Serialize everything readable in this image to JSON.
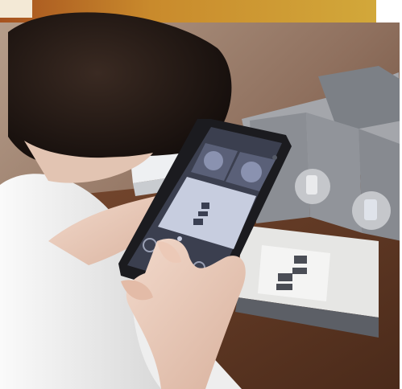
{
  "scene": {
    "description_colors": {
      "top_banner": "#c88a2a",
      "background_blur": "#9a7a66",
      "table_wood": "#6a3f28",
      "box_gray": "#8d9096",
      "box_lid": "#a9aaae",
      "card_light": "#e7e7e5",
      "phone_body": "#1c1c20",
      "phone_screen": "#3c4050",
      "screen_panel": "#c9cede",
      "hand_skin": "#e7c9b8",
      "shirt_white": "#f2f2f2",
      "hair_dark": "#221a16"
    }
  }
}
